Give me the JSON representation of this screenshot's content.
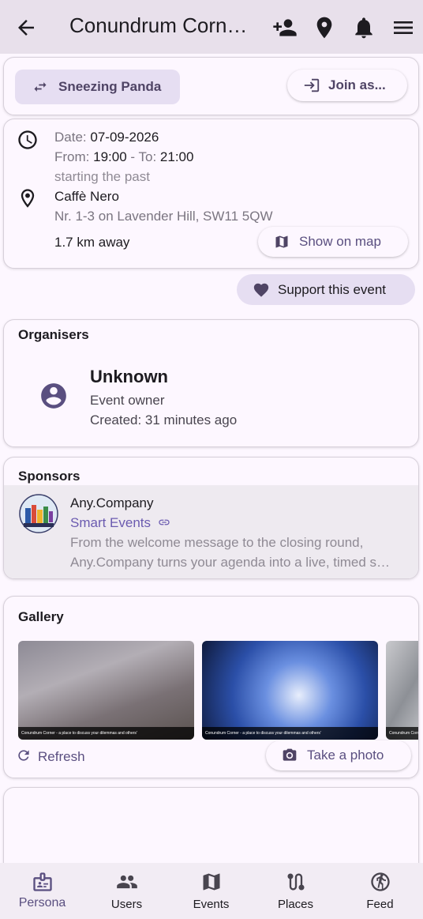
{
  "appbar": {
    "title": "Conundrum Corn…",
    "icons": [
      "arrow-back-icon",
      "person-add-icon",
      "location-pin-icon",
      "bell-icon",
      "menu-icon"
    ]
  },
  "identity": {
    "current_persona": "Sneezing Panda",
    "join_label": "Join as..."
  },
  "event": {
    "date_label": "Date:",
    "date_value": "07-09-2026",
    "from_label": "From:",
    "from_value": "19:00",
    "separator": "-",
    "to_label": "To:",
    "to_value": "21:00",
    "status": "starting the past",
    "venue": "Caffè Nero",
    "address": "Nr. 1-3 on Lavender Hill, SW11 5QW",
    "distance": "1.7 km away",
    "show_on_map": "Show on map"
  },
  "support_label": "Support this event",
  "organisers": {
    "title": "Organisers",
    "name": "Unknown",
    "role": "Event owner",
    "created": "Created: 31 minutes ago"
  },
  "sponsors": {
    "title": "Sponsors",
    "name": "Any.Company",
    "product": "Smart Events",
    "description_line1": "From the welcome message to the closing round,",
    "description_line2": "Any.Company turns your agenda into a live, timed s…"
  },
  "gallery": {
    "title": "Gallery",
    "caption": "Conundrum Corner - a place to discuss your dilemmas and others'",
    "refresh_label": "Refresh",
    "take_photo_label": "Take a photo"
  },
  "bottom_nav": {
    "items": [
      {
        "label": "Persona",
        "icon": "badge-icon",
        "active": true
      },
      {
        "label": "Users",
        "icon": "group-icon",
        "active": false
      },
      {
        "label": "Events",
        "icon": "map-icon",
        "active": false
      },
      {
        "label": "Places",
        "icon": "route-icon",
        "active": false
      },
      {
        "label": "Feed",
        "icon": "run-circle-icon",
        "active": false
      }
    ]
  },
  "colors": {
    "appbar_bg": "#e8e0eb",
    "page_bg": "#fdf7ff",
    "accent": "#6b5bb0",
    "tonal_button": "#e6def2",
    "nav_active": "#5a4f80"
  }
}
